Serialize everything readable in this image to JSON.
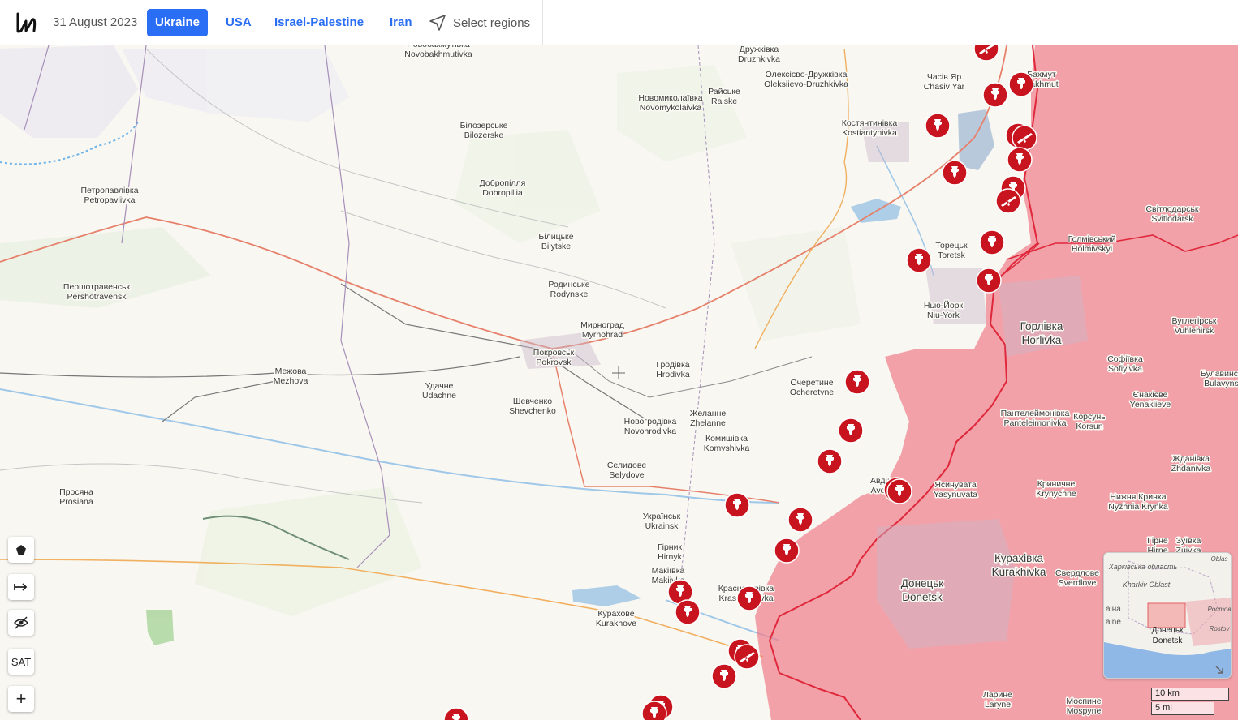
{
  "header": {
    "date": "31 August 2023",
    "tabs": [
      {
        "label": "Ukraine",
        "active": true
      },
      {
        "label": "USA",
        "active": false
      },
      {
        "label": "Israel-Palestine",
        "active": false
      },
      {
        "label": "Iran",
        "active": false
      }
    ],
    "select_regions_label": "Select regions"
  },
  "colors": {
    "occupied_area": "#f0808a",
    "frontline": "#e0283c",
    "marker": "#c8141e",
    "accent": "#2a6ef5",
    "water": "#aecde6"
  },
  "map": {
    "places": [
      {
        "ua": "Новобахмутівка",
        "en": "Novobakhmutivka"
      },
      {
        "ua": "Дружківка",
        "en": "Druzhkivka"
      },
      {
        "ua": "Олексієво-Дружківка",
        "en": "Oleksiievo-Druzhkivka"
      },
      {
        "ua": "Часів Яр",
        "en": "Chasiv Yar"
      },
      {
        "ua": "Бахмут",
        "en": "Bakhmut"
      },
      {
        "ua": "Райське",
        "en": "Raiske"
      },
      {
        "ua": "Новомиколаївка",
        "en": "Novomykolaivka"
      },
      {
        "ua": "Костянтинівка",
        "en": "Kostiantynivka"
      },
      {
        "ua": "Білозерське",
        "en": "Bilozerske"
      },
      {
        "ua": "Добропілля",
        "en": "Dobropillia"
      },
      {
        "ua": "Петропавлівка",
        "en": "Petropavlivka"
      },
      {
        "ua": "Білицьке",
        "en": "Bilytske"
      },
      {
        "ua": "Світлодарськ",
        "en": "Svitlodarsk"
      },
      {
        "ua": "Торецьк",
        "en": "Toretsk"
      },
      {
        "ua": "Голмівський",
        "en": "Holmivskyi"
      },
      {
        "ua": "Першотравенськ",
        "en": "Pershotravensk"
      },
      {
        "ua": "Родинське",
        "en": "Rodynske"
      },
      {
        "ua": "Нью-Йорк",
        "en": "Niu-York"
      },
      {
        "ua": "Мирноград",
        "en": "Myrnohrad"
      },
      {
        "ua": "Горлівка",
        "en": "Horlivka"
      },
      {
        "ua": "Вуглегірськ",
        "en": "Vuhlehirsk"
      },
      {
        "ua": "Покровськ",
        "en": "Pokrovsk"
      },
      {
        "ua": "Гродівка",
        "en": "Hrodivka"
      },
      {
        "ua": "Межова",
        "en": "Mezhova"
      },
      {
        "ua": "Удачне",
        "en": "Udachne"
      },
      {
        "ua": "Очеретине",
        "en": "Ocheretyne"
      },
      {
        "ua": "Софіївка",
        "en": "Sofiyivka"
      },
      {
        "ua": "Єнакієве",
        "en": "Yenakiieve"
      },
      {
        "ua": "Шевченко",
        "en": "Shevchenko"
      },
      {
        "ua": "Желанне",
        "en": "Zhelanne"
      },
      {
        "ua": "Новогродівка",
        "en": "Novohrodivka"
      },
      {
        "ua": "Пантелеймонівка",
        "en": "Panteleimonivka"
      },
      {
        "ua": "Корсунь",
        "en": "Korsun"
      },
      {
        "ua": "Комишівка",
        "en": "Komyshivka"
      },
      {
        "ua": "Жданівка",
        "en": "Zhdanivka"
      },
      {
        "ua": "Селидове",
        "en": "Selydove"
      },
      {
        "ua": "Авдіївка",
        "en": "Avdiivka"
      },
      {
        "ua": "Ясинувата",
        "en": "Yasynuvata"
      },
      {
        "ua": "Криничне",
        "en": "Krynychne"
      },
      {
        "ua": "Просяна",
        "en": "Prosiana"
      },
      {
        "ua": "Нижня Кринка",
        "en": "Nyzhnia Krynka"
      },
      {
        "ua": "Українськ",
        "en": "Ukrainsk"
      },
      {
        "ua": "Гірник",
        "en": "Hirnyk"
      },
      {
        "ua": "Макіївка",
        "en": "Makiivka"
      },
      {
        "ua": "Курахівка",
        "en": "Kurakhivka"
      },
      {
        "ua": "Донецьк",
        "en": "Donetsk"
      },
      {
        "ua": "Свердлове",
        "en": "Sverdlove"
      },
      {
        "ua": "Красногорівка",
        "en": "Krasnohorivka"
      },
      {
        "ua": "Курахове",
        "en": "Kurakhove"
      },
      {
        "ua": "Ларине",
        "en": "Laryne"
      },
      {
        "ua": "Моспине",
        "en": "Mospyne"
      },
      {
        "ua": "Булавинське",
        "en": "Bulavynske"
      },
      {
        "ua": "Гірне",
        "en": "Hirne"
      },
      {
        "ua": "Зуївка",
        "en": "Zuivka"
      }
    ],
    "map_controls": [
      "polygon-tool",
      "measure-tool",
      "hide-layer",
      "SAT",
      "+"
    ]
  },
  "minimap": {
    "labels": [
      "Харківська область",
      "Kharkiv Oblast",
      "Донецьк",
      "Donetsk",
      "Ростов",
      "Rostov",
      "Oblas",
      "аіна",
      "aine"
    ]
  },
  "scale": {
    "metric": "10 km",
    "imperial": "5 mi"
  }
}
